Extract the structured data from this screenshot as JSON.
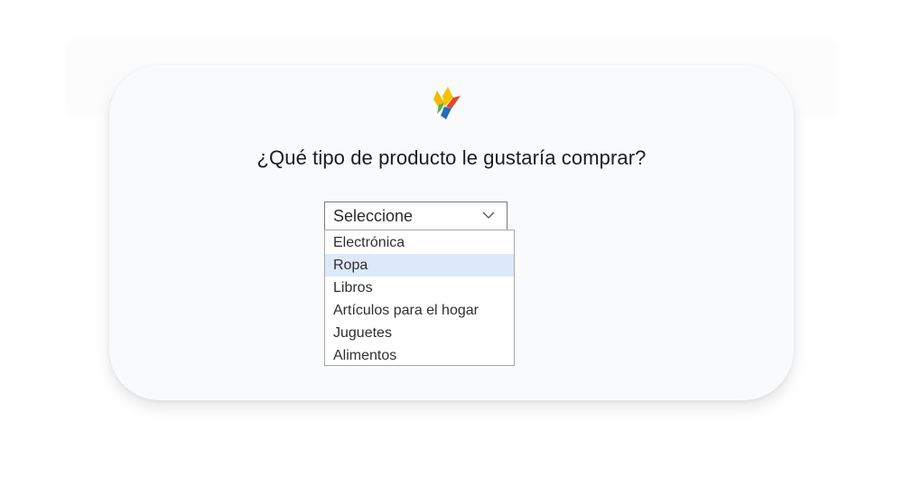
{
  "question": "¿Qué tipo de producto le gustaría comprar?",
  "select": {
    "value": "Seleccione",
    "icon": "chevron-down-icon"
  },
  "logo": {
    "icon": "bird-logo-icon",
    "colors": [
      "#f2b900",
      "#e8442a",
      "#2b6bb5",
      "#55b04a"
    ]
  },
  "options": [
    {
      "label": "Electrónica"
    },
    {
      "label": "Ropa"
    },
    {
      "label": "Libros"
    },
    {
      "label": "Artículos para el hogar"
    },
    {
      "label": "Juguetes"
    },
    {
      "label": "Alimentos"
    }
  ],
  "highlighted_option_index": 1,
  "colors": {
    "highlight": "#dde9fb",
    "card_background": "#f9fafc",
    "text": "#1c1c1c"
  }
}
